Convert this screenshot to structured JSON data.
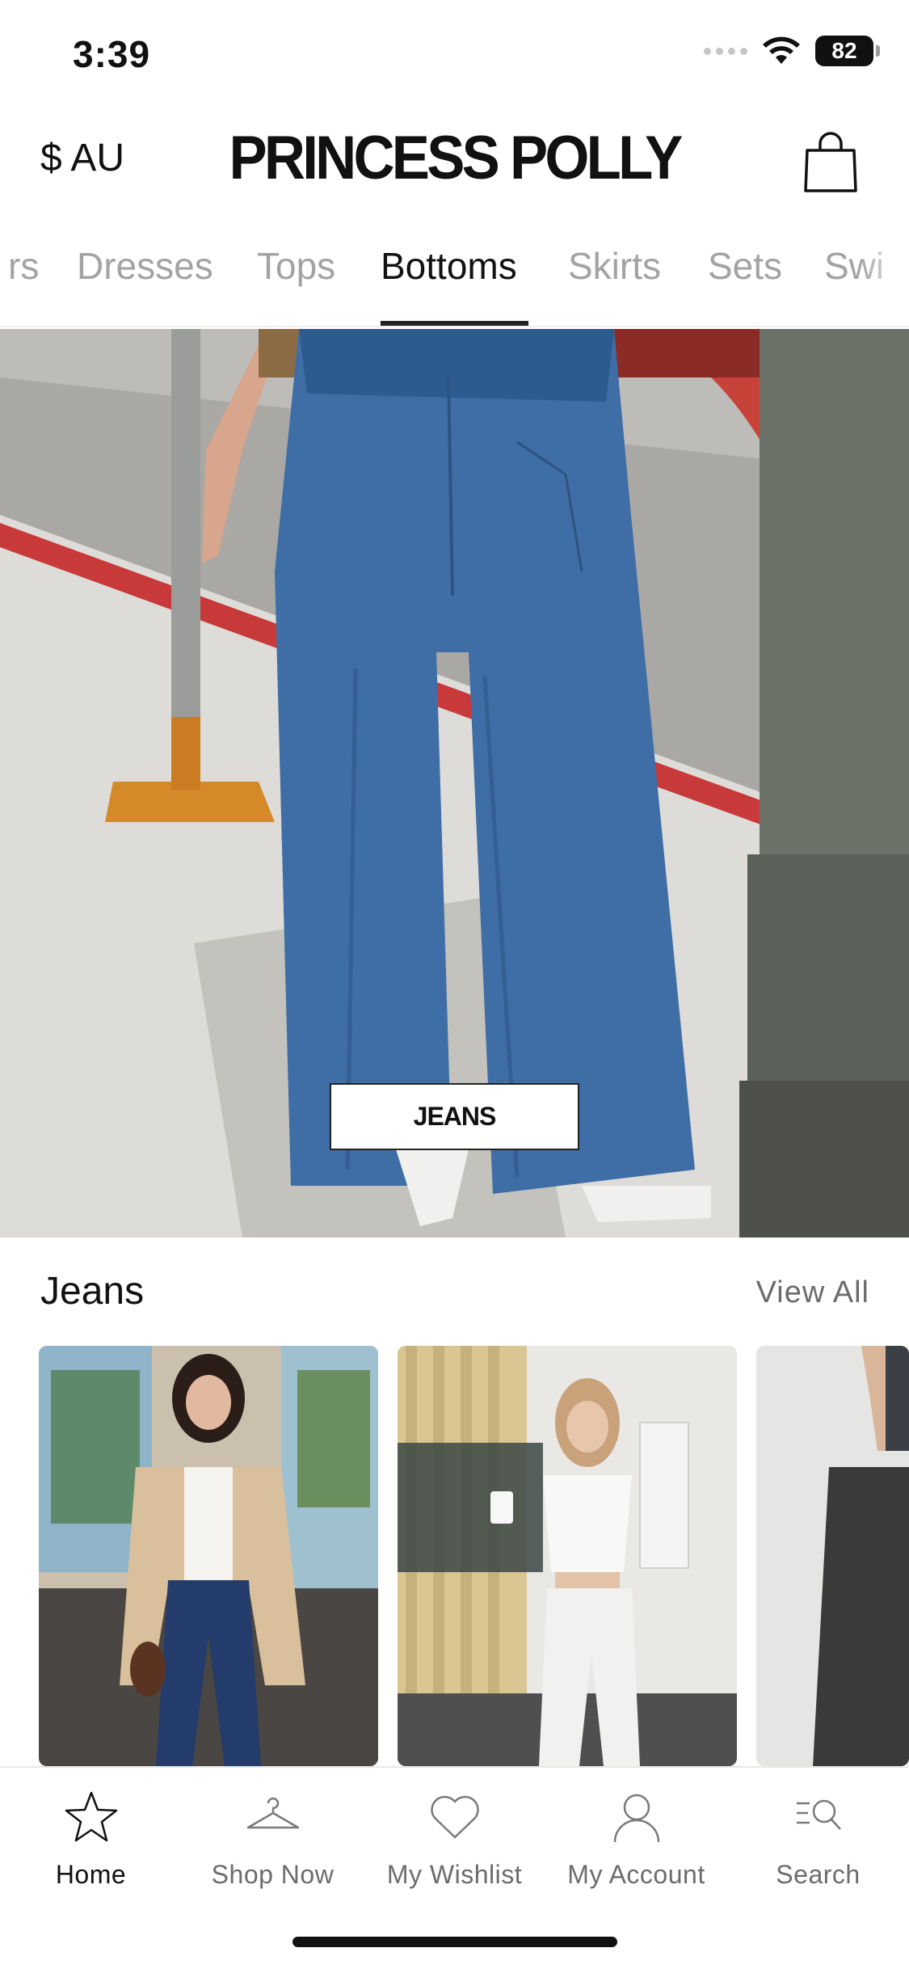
{
  "status_bar": {
    "time": "3:39",
    "battery": "82"
  },
  "header": {
    "currency": "$ AU",
    "brand": "PRINCESS POLLY",
    "bag_icon": "shopping-bag-icon"
  },
  "category_tabs": [
    {
      "label": "rs"
    },
    {
      "label": "Dresses"
    },
    {
      "label": "Tops"
    },
    {
      "label": "Bottoms",
      "active": true
    },
    {
      "label": "Skirts"
    },
    {
      "label": "Sets"
    },
    {
      "label": "Swi"
    }
  ],
  "hero": {
    "button_label": "JEANS"
  },
  "section": {
    "title": "Jeans",
    "view_all": "View All"
  },
  "bottom_nav": [
    {
      "label": "Home",
      "icon": "star-icon",
      "active": true
    },
    {
      "label": "Shop Now",
      "icon": "hanger-icon"
    },
    {
      "label": "My Wishlist",
      "icon": "heart-icon"
    },
    {
      "label": "My Account",
      "icon": "user-icon"
    },
    {
      "label": "Search",
      "icon": "search-icon"
    }
  ],
  "colors": {
    "accent": "#111111",
    "inactive_tab": "#a3a3a3",
    "denim": "#3a6aa3"
  }
}
